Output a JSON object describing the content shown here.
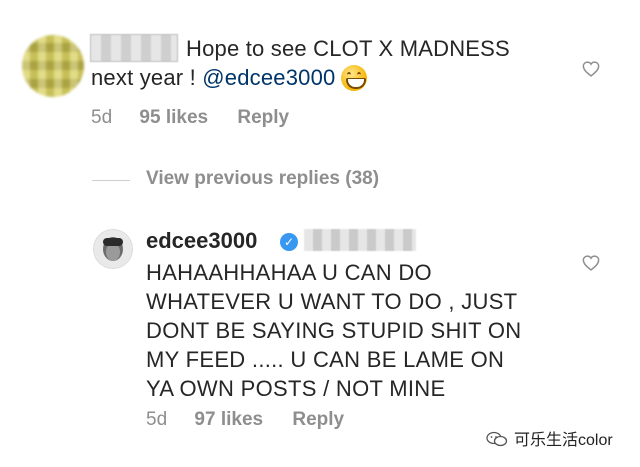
{
  "comment": {
    "text_line1": "Hope to see CLOT  X  MADNESS",
    "text_line2_prefix": "next year ! ",
    "mention": "@edcee3000",
    "emoji_icon": "grinning-face-icon",
    "timestamp": "5d",
    "likes": "95 likes",
    "reply_label": "Reply"
  },
  "thread": {
    "view_replies": "View previous replies (38)"
  },
  "reply": {
    "username": "edcee3000",
    "verified_icon": "verified-badge-icon",
    "text": "HAHAAHHAHAA U CAN DO\nWHATEVER U WANT TO DO , JUST\nDONT BE SAYING STUPID SHIT ON\nMY FEED ..... U CAN BE LAME ON\nYA OWN POSTS / NOT MINE",
    "timestamp": "5d",
    "likes": "97 likes",
    "reply_label": "Reply"
  },
  "watermark": {
    "text": "可乐生活color"
  },
  "colors": {
    "mention": "#003569",
    "meta": "#8e8e8e",
    "verified": "#3897f0"
  }
}
